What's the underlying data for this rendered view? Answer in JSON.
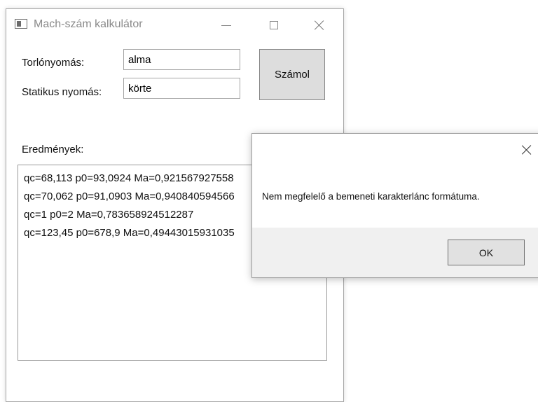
{
  "window": {
    "title": "Mach-szám kalkulátor",
    "controls": {
      "minimize": "minimize-icon",
      "maximize": "maximize-icon",
      "close": "close-icon"
    }
  },
  "form": {
    "torlonyomas_label": "Torlónyomás:",
    "torlonyomas_value": "alma",
    "statikus_label": "Statikus nyomás:",
    "statikus_value": "körte",
    "calc_button": "Számol",
    "results_label": "Eredmények:"
  },
  "results": [
    "qc=68,113 p0=93,0924 Ma=0,921567927558",
    "qc=70,062 p0=91,0903 Ma=0,940840594566",
    "qc=1 p0=2 Ma=0,783658924512287",
    "qc=123,45 p0=678,9 Ma=0,49443015931035"
  ],
  "dialog": {
    "message": "Nem megfelelő a bemeneti karakterlánc formátuma.",
    "ok_label": "OK"
  }
}
